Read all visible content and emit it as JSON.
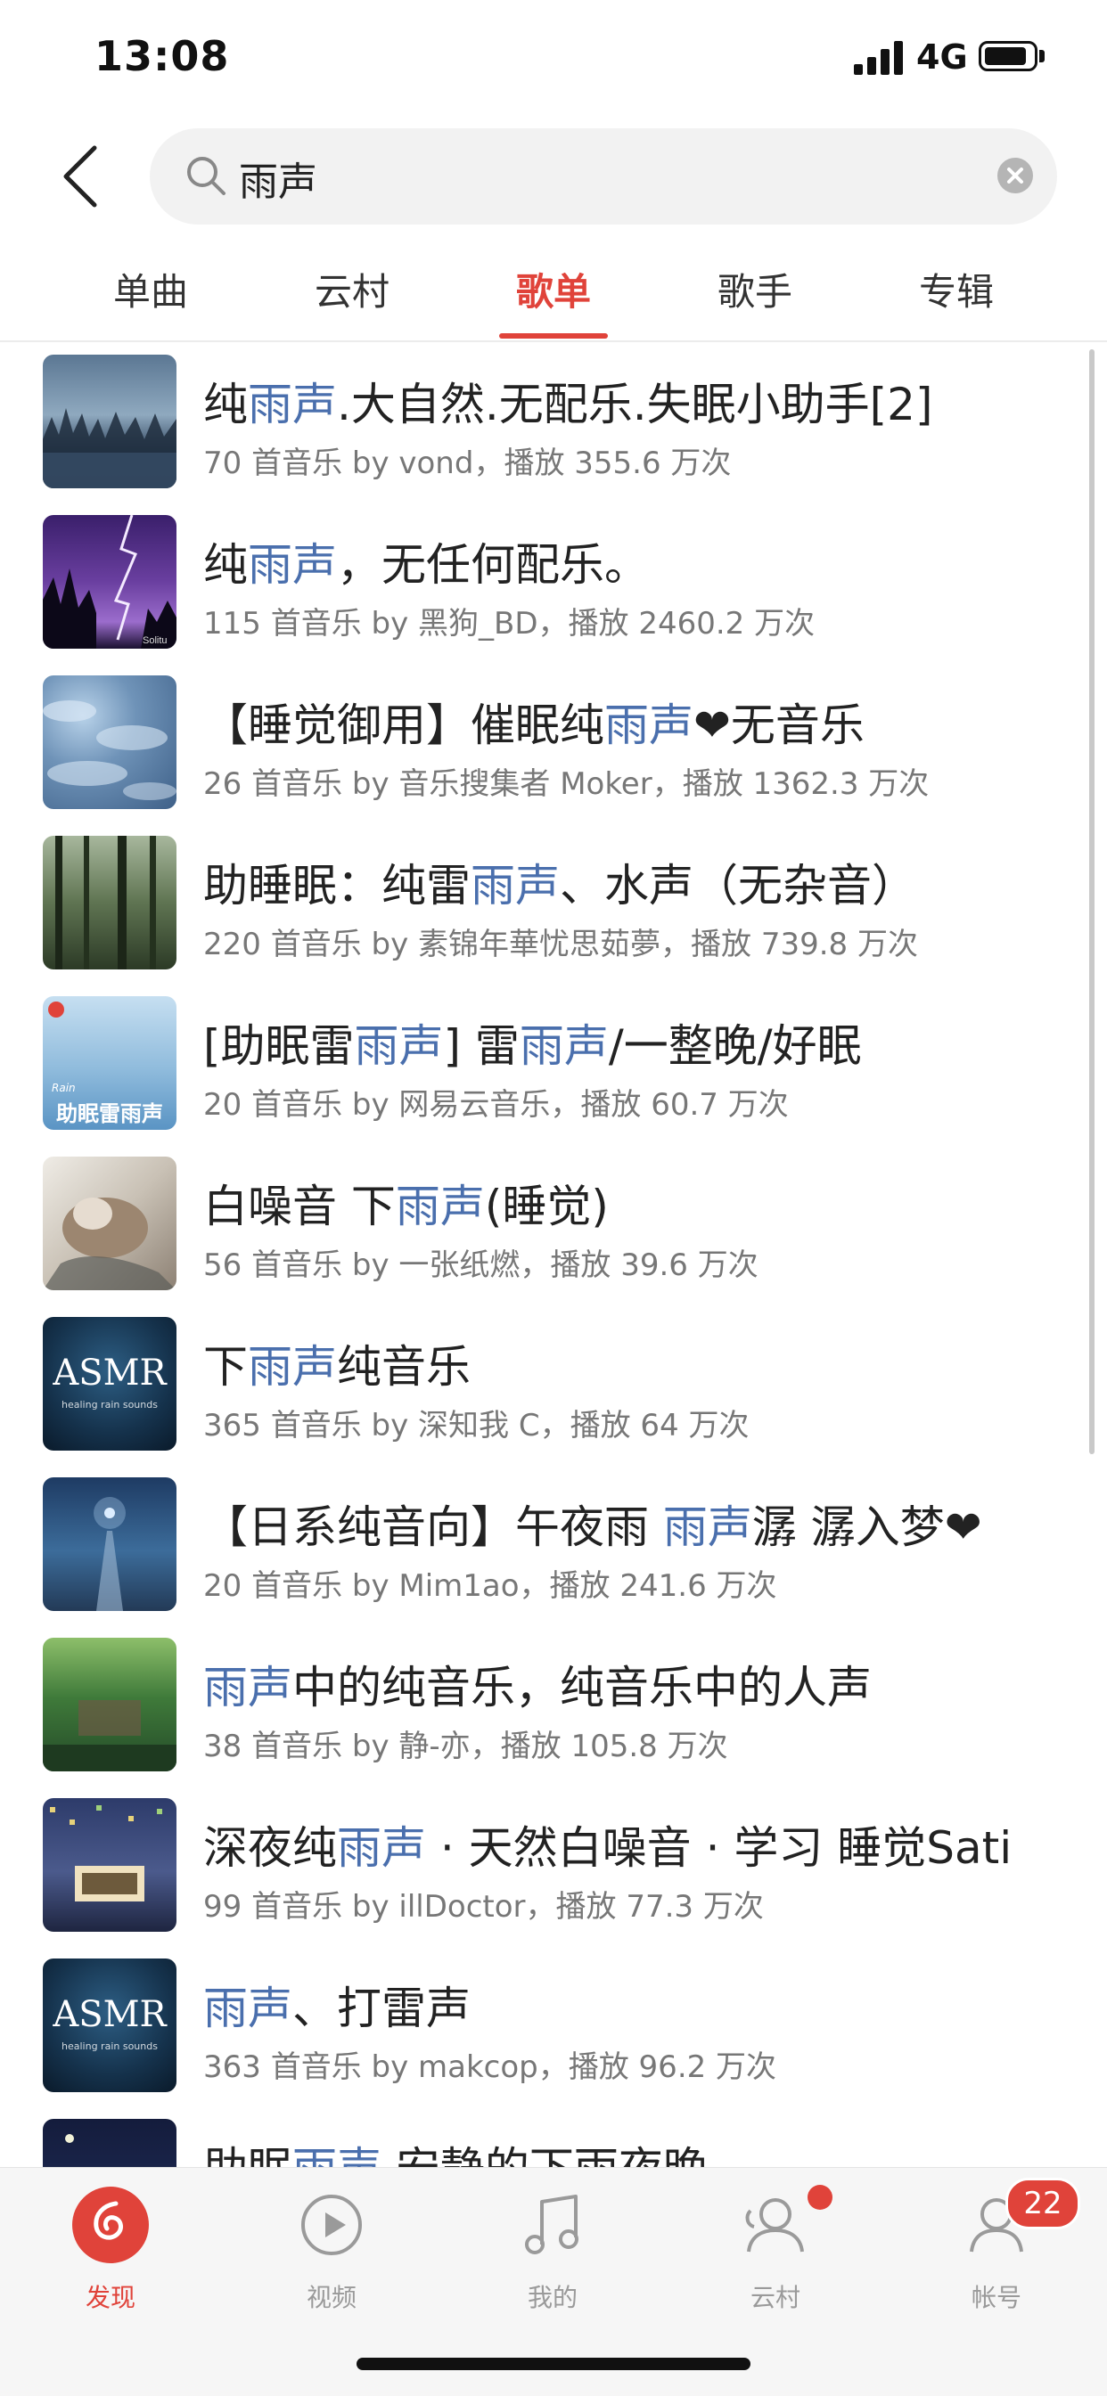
{
  "status_bar": {
    "time": "13:08",
    "network": "4G"
  },
  "search": {
    "query": "雨声"
  },
  "tabs": [
    {
      "label": "单曲"
    },
    {
      "label": "云村"
    },
    {
      "label": "歌单"
    },
    {
      "label": "歌手"
    },
    {
      "label": "专辑"
    }
  ],
  "active_tab": "歌单",
  "playlists": [
    {
      "title": {
        "pre": "纯",
        "hl": "雨声",
        "post": ".大自然.无配乐.失眠小助手[2]"
      },
      "meta": "70 首音乐  by vond，播放 355.6 万次"
    },
    {
      "title": {
        "pre": "纯",
        "hl": "雨声",
        "post": "，无任何配乐。"
      },
      "meta": "115 首音乐  by 黑狗_BD，播放 2460.2 万次"
    },
    {
      "title": {
        "pre": "【睡觉御用】催眠纯",
        "hl": "雨声",
        "post": "❤无音乐"
      },
      "meta": "26 首音乐  by 音乐搜集者 Moker，播放 1362.3 万次"
    },
    {
      "title": {
        "pre": "助睡眠：纯雷",
        "hl": "雨声",
        "post": "、水声（无杂音）"
      },
      "meta": "220 首音乐  by 素锦年華忧思茹夢，播放 739.8 万次"
    },
    {
      "title": {
        "pre": "[助眠雷",
        "hl": "雨声",
        "post": "] 雷"
      },
      "title_extra": {
        "hl": "雨声",
        "post": "/一整晚/好眠"
      },
      "meta": "20 首音乐  by 网易云音乐，播放 60.7 万次"
    },
    {
      "title": {
        "pre": "白噪音 下",
        "hl": "雨声",
        "post": "(睡觉)"
      },
      "meta": "56 首音乐  by 一张纸燃，播放 39.6 万次"
    },
    {
      "title": {
        "pre": "下",
        "hl": "雨声",
        "post": "纯音乐"
      },
      "meta": "365 首音乐  by 深知我 C，播放 64 万次"
    },
    {
      "title": {
        "pre": "【日系纯音向】午夜雨 ",
        "hl": "雨声",
        "post": "潺 潺入梦❤"
      },
      "meta": "20 首音乐  by Mim1ao，播放 241.6 万次"
    },
    {
      "title": {
        "pre": "",
        "hl": "雨声",
        "post": "中的纯音乐，纯音乐中的人声"
      },
      "meta": "38 首音乐  by 静-亦，播放 105.8 万次"
    },
    {
      "title": {
        "pre": "深夜纯",
        "hl": "雨声",
        "post": " · 天然白噪音 · 学习 睡觉Sati"
      },
      "meta": "99 首音乐  by illDoctor，播放 77.3 万次"
    },
    {
      "title": {
        "pre": "",
        "hl": "雨声",
        "post": "、打雷声"
      },
      "meta": "363 首音乐  by makcop，播放 96.2 万次"
    },
    {
      "title": {
        "pre": "助眠",
        "hl": "雨声",
        "post": " 安静的下雨夜晚"
      },
      "meta": ""
    }
  ],
  "covers": {
    "rain_label_small": "Rain",
    "rain_label": "助眠雷雨声",
    "asmr_label": "ASMR",
    "asmr_sub": "healing rain sounds",
    "storm_signature": "Solitu"
  },
  "bottom_nav": [
    {
      "label": "发现",
      "icon": "discover-icon"
    },
    {
      "label": "视频",
      "icon": "video-icon"
    },
    {
      "label": "我的",
      "icon": "music-note-icon"
    },
    {
      "label": "云村",
      "icon": "friends-icon"
    },
    {
      "label": "帐号",
      "icon": "account-icon"
    }
  ],
  "account_badge": "22",
  "colors": {
    "accent": "#e0433a",
    "highlight": "#4a6fad"
  }
}
